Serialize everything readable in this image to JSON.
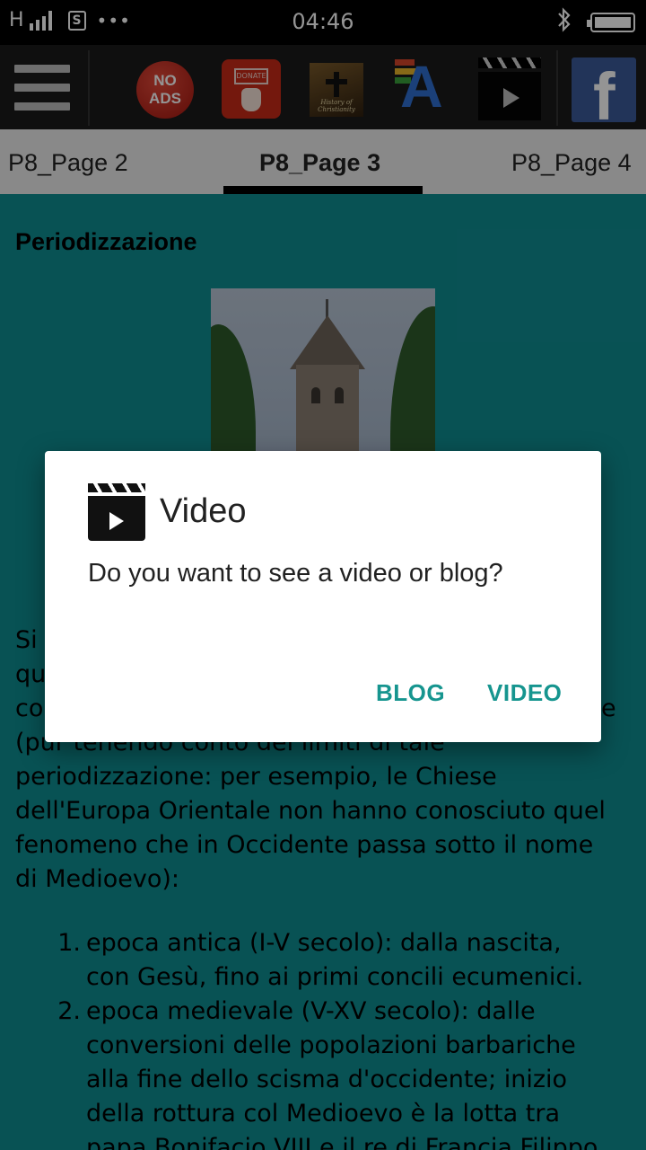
{
  "status_bar": {
    "network": "H",
    "time": "04:46",
    "sim_label": "S",
    "more": "•••"
  },
  "toolbar": {
    "icons": [
      "menu-icon",
      "no-ads-icon",
      "donate-icon",
      "history-of-christianity-icon",
      "font-size-icon",
      "video-clapper-icon",
      "facebook-icon"
    ],
    "no_ads_line1": "NO",
    "no_ads_line2": "ADS",
    "donate_label": "DONATE",
    "history_label": "History of Christianity",
    "font_letter": "A",
    "facebook_letter": "f"
  },
  "tabs": {
    "items": [
      {
        "label": "P8_Page 2"
      },
      {
        "label": "P8_Page 3",
        "active": true
      },
      {
        "label": "P8_Page 4"
      }
    ]
  },
  "content": {
    "heading": "Periodizzazione",
    "paragraph_lines": [
      "Si",
      "qu",
      "co",
      "(pur tenendo conto dei limiti di tale",
      "periodizzazione: per esempio, le Chiese",
      "dell'Europa Orientale non hanno conosciuto quel",
      "fenomeno che in Occidente passa sotto il nome",
      "di Medioevo):"
    ],
    "paragraph_line3_tail": "e",
    "list": [
      {
        "num": "1.",
        "lines": [
          "epoca antica (I-V secolo): dalla nascita,",
          "con Gesù, fino ai primi concili ecumenici."
        ]
      },
      {
        "num": "2.",
        "lines": [
          "epoca medievale (V-XV secolo): dalle",
          "conversioni delle popolazioni barbariche",
          "alla fine dello scisma d'occidente; inizio",
          "della rottura col Medioevo è la lotta tra",
          "papa Bonifacio VIII e il re di Francia Filippo"
        ]
      }
    ]
  },
  "dialog": {
    "icon": "video-clapper-icon",
    "title": "Video",
    "message": "Do you want to see a video or blog?",
    "buttons": {
      "blog": "BLOG",
      "video": "VIDEO"
    },
    "accent_color": "#16958f"
  },
  "colors": {
    "content_background": "#0f8d92",
    "toolbar_background": "#1a1a1a",
    "tab_background": "#ececec"
  }
}
